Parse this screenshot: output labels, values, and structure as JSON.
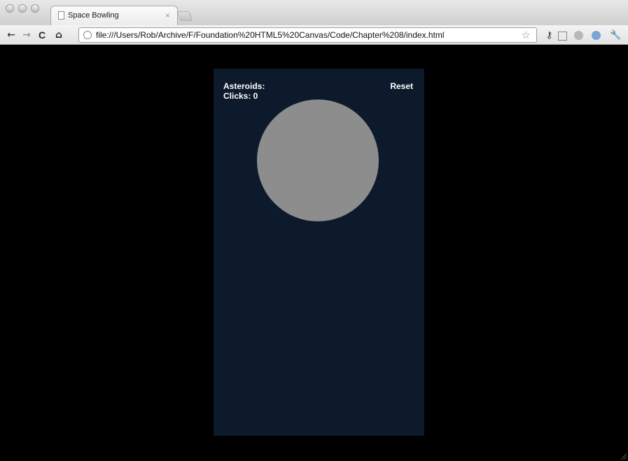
{
  "browser": {
    "tab": {
      "title": "Space Bowling",
      "close": "×"
    },
    "new_tab": "+",
    "toolbar": {
      "back": "←",
      "forward": "→",
      "reload": "C",
      "home": "⌂"
    },
    "address": {
      "url": "file:///Users/Rob/Archive/F/Foundation%20HTML5%20Canvas/Code/Chapter%208/index.html"
    }
  },
  "game": {
    "asteroids_label": "Asteroids:",
    "clicks_label": "Clicks: 0",
    "reset_label": "Reset",
    "colors": {
      "page_background": "#000000",
      "canvas_background": "#0c1a2b",
      "platform": "#8d8d8d",
      "text": "#ffffff"
    }
  }
}
